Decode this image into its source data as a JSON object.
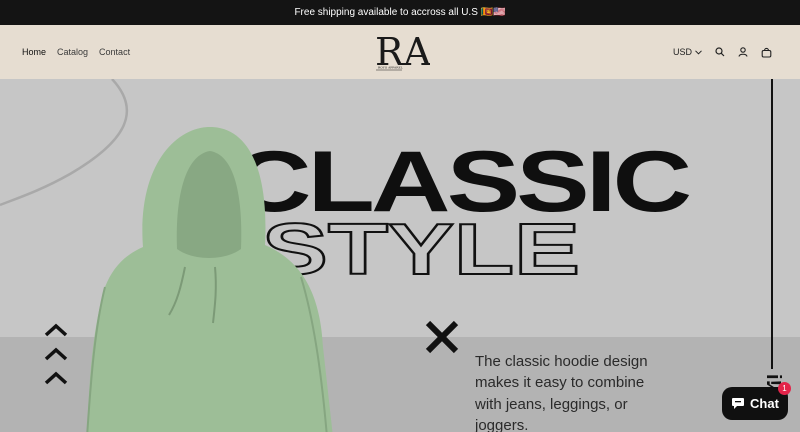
{
  "announcement": {
    "text": "Free shipping available to accross all U.S 🇱🇰🇺🇸"
  },
  "nav": {
    "home": "Home",
    "catalog": "Catalog",
    "contact": "Contact"
  },
  "logo": {
    "letters": "RA",
    "tagline": "ROYO APPAREL"
  },
  "header": {
    "currency": "USD"
  },
  "icons": [
    "chevron-down-icon",
    "search-icon",
    "account-icon",
    "cart-icon",
    "chevron-up-icon",
    "close-icon",
    "chat-icon"
  ],
  "hero": {
    "title_line1": "CLASSIC",
    "title_line2": "STYLE",
    "description": "The classic hoodie design makes it easy to combine with jeans, leggings, or joggers.",
    "vertical_text": "i!∕"
  },
  "chat": {
    "label": "Chat",
    "badge": "1"
  },
  "colors": {
    "announcement_bg": "#141414",
    "header_bg": "#e6ddd1",
    "hero_bg": "#c6c6c6",
    "hoodie": "#9dbe97",
    "chat_bg": "#101010",
    "badge": "#e3244a"
  }
}
